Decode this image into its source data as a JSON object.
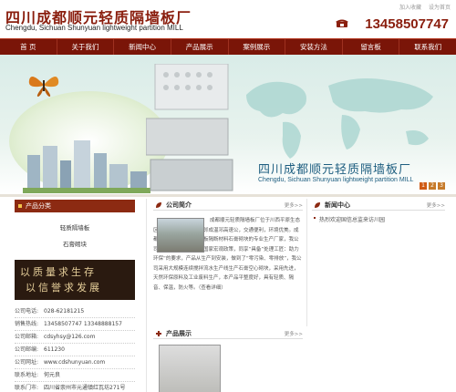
{
  "header": {
    "title_cn": "四川成都顺元轻质隔墙板厂",
    "title_en": "Chengdu, Sichuan Shunyuan lightweight partition MILL",
    "top_links": [
      "加入收藏",
      "设为首页"
    ],
    "phone": "13458507747"
  },
  "nav": {
    "items": [
      "首  页",
      "关于我们",
      "新闻中心",
      "产品展示",
      "案例展示",
      "安装方法",
      "留言板",
      "联系我们"
    ]
  },
  "banner": {
    "title": "四川成都顺元轻质隔墙板厂",
    "subtitle": "Chengdu, Sichuan Shunyuan lightweight partition MILL",
    "pages": [
      "1",
      "2",
      "3"
    ]
  },
  "left": {
    "category_title": "产品分类",
    "categories": [
      "轻质隔墙板",
      "石膏砌块"
    ],
    "calligraphy_line1": "以质量求生存",
    "calligraphy_line2": "以信誉求发展",
    "contact": [
      {
        "k": "公司电话:",
        "v": "028-62181215"
      },
      {
        "k": "销售热线:",
        "v": "13458507747  13348888157"
      },
      {
        "k": "公司邮箱:",
        "v": "cdsyhsy@126.com"
      },
      {
        "k": "公司邮编:",
        "v": "611230"
      },
      {
        "k": "公司网址:",
        "v": "www.cdshunyuan.com"
      },
      {
        "k": "联系地址:",
        "v": "何元良"
      },
      {
        "k": "联系门市:",
        "v": "四川省崇州市元通镇红瓦坊271号"
      }
    ]
  },
  "middle": {
    "intro_title": "公司简介",
    "intro_more": "更多>>",
    "intro_text": "成都顺元轻质隔墙板厂位于川西平原生态区——崇州市北郊，毗邻成温邛高速公，交通便利，环境优美。成都地区最大的轻质隔墙板隔断材料石膏砌块的专业生产厂家，我公司生产的石膏砌块符合国家宏观政策，同享“具备”处理工匠：助力环保“的要求，产品从生产到安装，做到了“零污染、零排放”，我公司采用大规模连续搅拌流水生产线生产石膏空心砌块，采用先进，天然环保原料及工业废料生产，本产品平整度好，具有轻质、隔音、保温，防火等。（查看详细）",
    "products_title": "产品展示",
    "products_more": "更多>>"
  },
  "right": {
    "news_title": "新闻中心",
    "news_more": "更多>>",
    "news_items": [
      "热烈欢迎国信总监来访川园"
    ]
  },
  "colors": {
    "brand_red": "#8a1e0e",
    "nav_bg": "#7a1508",
    "banner_text": "#1e5e80"
  }
}
